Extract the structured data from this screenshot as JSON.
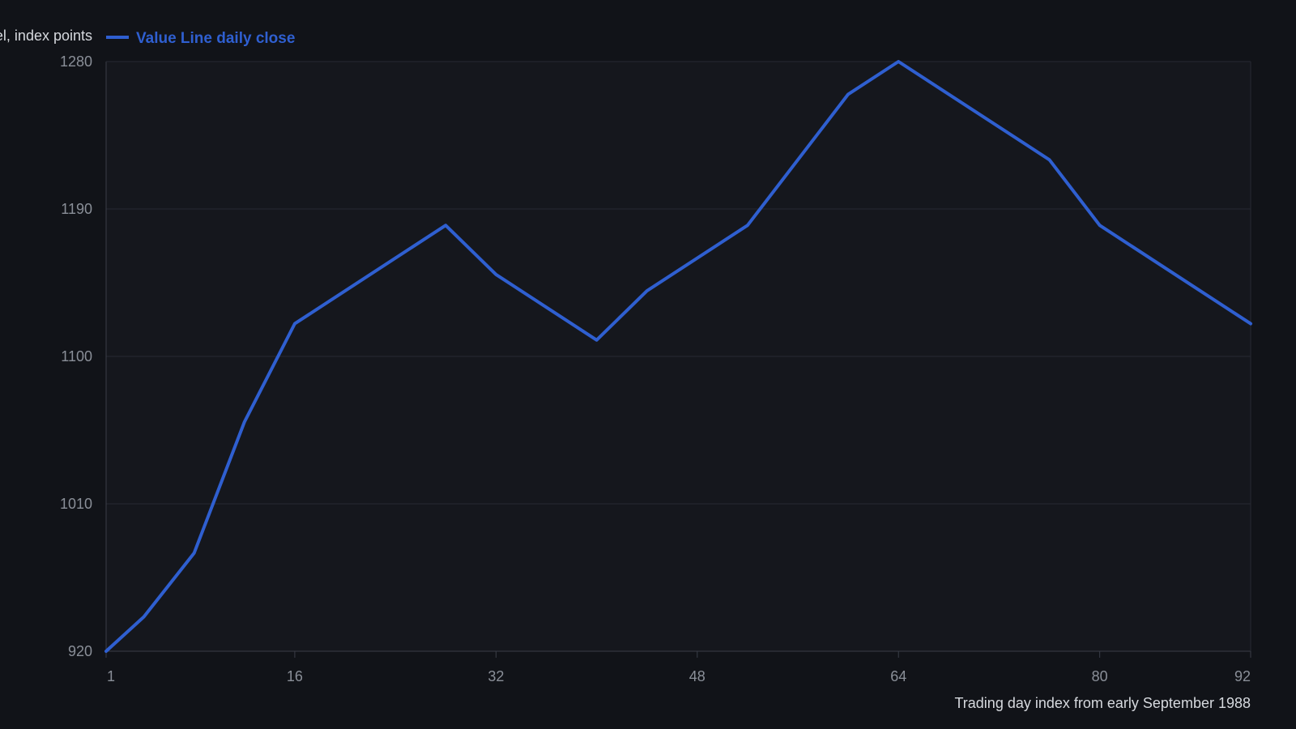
{
  "chart_data": {
    "type": "line",
    "ylabel": "Value Line index level, index points",
    "xlabel": "Trading day index from early September 1988",
    "x_ticks": [
      1,
      16,
      32,
      48,
      64,
      80,
      92
    ],
    "y_ticks": [
      920,
      1010,
      1100,
      1190,
      1280
    ],
    "xlim": [
      1,
      92
    ],
    "ylim": [
      920,
      1280
    ],
    "grid": true,
    "legend_position": "top-left",
    "series": [
      {
        "name": "Value Line daily close",
        "color": "#2f5fd0",
        "points": [
          [
            1,
            920
          ],
          [
            4,
            941
          ],
          [
            8,
            980
          ],
          [
            12,
            1060
          ],
          [
            16,
            1120
          ],
          [
            28,
            1180
          ],
          [
            32,
            1150
          ],
          [
            40,
            1110
          ],
          [
            44,
            1140
          ],
          [
            52,
            1180
          ],
          [
            60,
            1260
          ],
          [
            64,
            1280
          ],
          [
            76,
            1220
          ],
          [
            80,
            1180
          ],
          [
            92,
            1120
          ]
        ]
      }
    ]
  },
  "colors": {
    "page_background": "#111318",
    "plot_background": "#15171d",
    "grid": "#262932",
    "axis": "#3a3e48",
    "tick_text": "#8a8f98",
    "title_text": "#d6d9de"
  }
}
